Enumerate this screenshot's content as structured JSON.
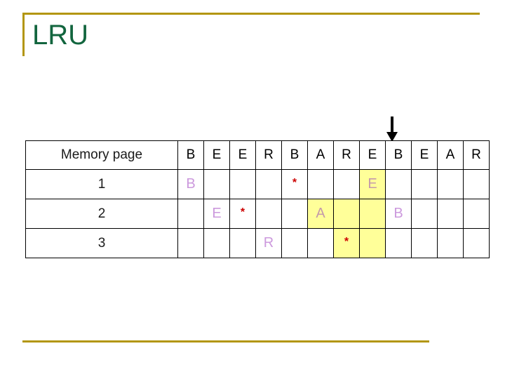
{
  "slide": {
    "title": "LRU",
    "accent_color": "#b3960f",
    "title_color": "#12653e"
  },
  "pointer": {
    "icon": "down-arrow-icon",
    "points_at_column_index": 8,
    "points_at_column_label": "B",
    "color": "#000000"
  },
  "table": {
    "row_label_header": "Memory page",
    "columns": [
      "B",
      "E",
      "E",
      "R",
      "B",
      "A",
      "R",
      "E",
      "B",
      "E",
      "A",
      "R"
    ],
    "colors": {
      "reference_letter": "#cc99dd",
      "star": "#cc0000",
      "highlight": "#ffff99",
      "grid": "#000000"
    },
    "rows": [
      {
        "label": "1",
        "cells": [
          {
            "text": "B",
            "kind": "ref",
            "highlight": false
          },
          {
            "text": "",
            "kind": "empty",
            "highlight": false
          },
          {
            "text": "",
            "kind": "empty",
            "highlight": false
          },
          {
            "text": "",
            "kind": "empty",
            "highlight": false
          },
          {
            "text": "*",
            "kind": "star",
            "highlight": false
          },
          {
            "text": "",
            "kind": "empty",
            "highlight": false
          },
          {
            "text": "",
            "kind": "empty",
            "highlight": false
          },
          {
            "text": "E",
            "kind": "ref",
            "highlight": true
          },
          {
            "text": "",
            "kind": "empty",
            "highlight": false
          },
          {
            "text": "",
            "kind": "empty",
            "highlight": false
          },
          {
            "text": "",
            "kind": "empty",
            "highlight": false
          },
          {
            "text": "",
            "kind": "empty",
            "highlight": false
          }
        ]
      },
      {
        "label": "2",
        "cells": [
          {
            "text": "",
            "kind": "empty",
            "highlight": false
          },
          {
            "text": "E",
            "kind": "ref",
            "highlight": false
          },
          {
            "text": "*",
            "kind": "star",
            "highlight": false
          },
          {
            "text": "",
            "kind": "empty",
            "highlight": false
          },
          {
            "text": "",
            "kind": "empty",
            "highlight": false
          },
          {
            "text": "A",
            "kind": "ref",
            "highlight": true
          },
          {
            "text": "",
            "kind": "empty",
            "highlight": true
          },
          {
            "text": "",
            "kind": "empty",
            "highlight": true
          },
          {
            "text": "B",
            "kind": "ref",
            "highlight": false
          },
          {
            "text": "",
            "kind": "empty",
            "highlight": false
          },
          {
            "text": "",
            "kind": "empty",
            "highlight": false
          },
          {
            "text": "",
            "kind": "empty",
            "highlight": false
          }
        ]
      },
      {
        "label": "3",
        "cells": [
          {
            "text": "",
            "kind": "empty",
            "highlight": false
          },
          {
            "text": "",
            "kind": "empty",
            "highlight": false
          },
          {
            "text": "",
            "kind": "empty",
            "highlight": false
          },
          {
            "text": "R",
            "kind": "ref",
            "highlight": false
          },
          {
            "text": "",
            "kind": "empty",
            "highlight": false
          },
          {
            "text": "",
            "kind": "empty",
            "highlight": false
          },
          {
            "text": "*",
            "kind": "star",
            "highlight": true
          },
          {
            "text": "",
            "kind": "empty",
            "highlight": true
          },
          {
            "text": "",
            "kind": "empty",
            "highlight": false
          },
          {
            "text": "",
            "kind": "empty",
            "highlight": false
          },
          {
            "text": "",
            "kind": "empty",
            "highlight": false
          },
          {
            "text": "",
            "kind": "empty",
            "highlight": false
          }
        ]
      }
    ]
  }
}
